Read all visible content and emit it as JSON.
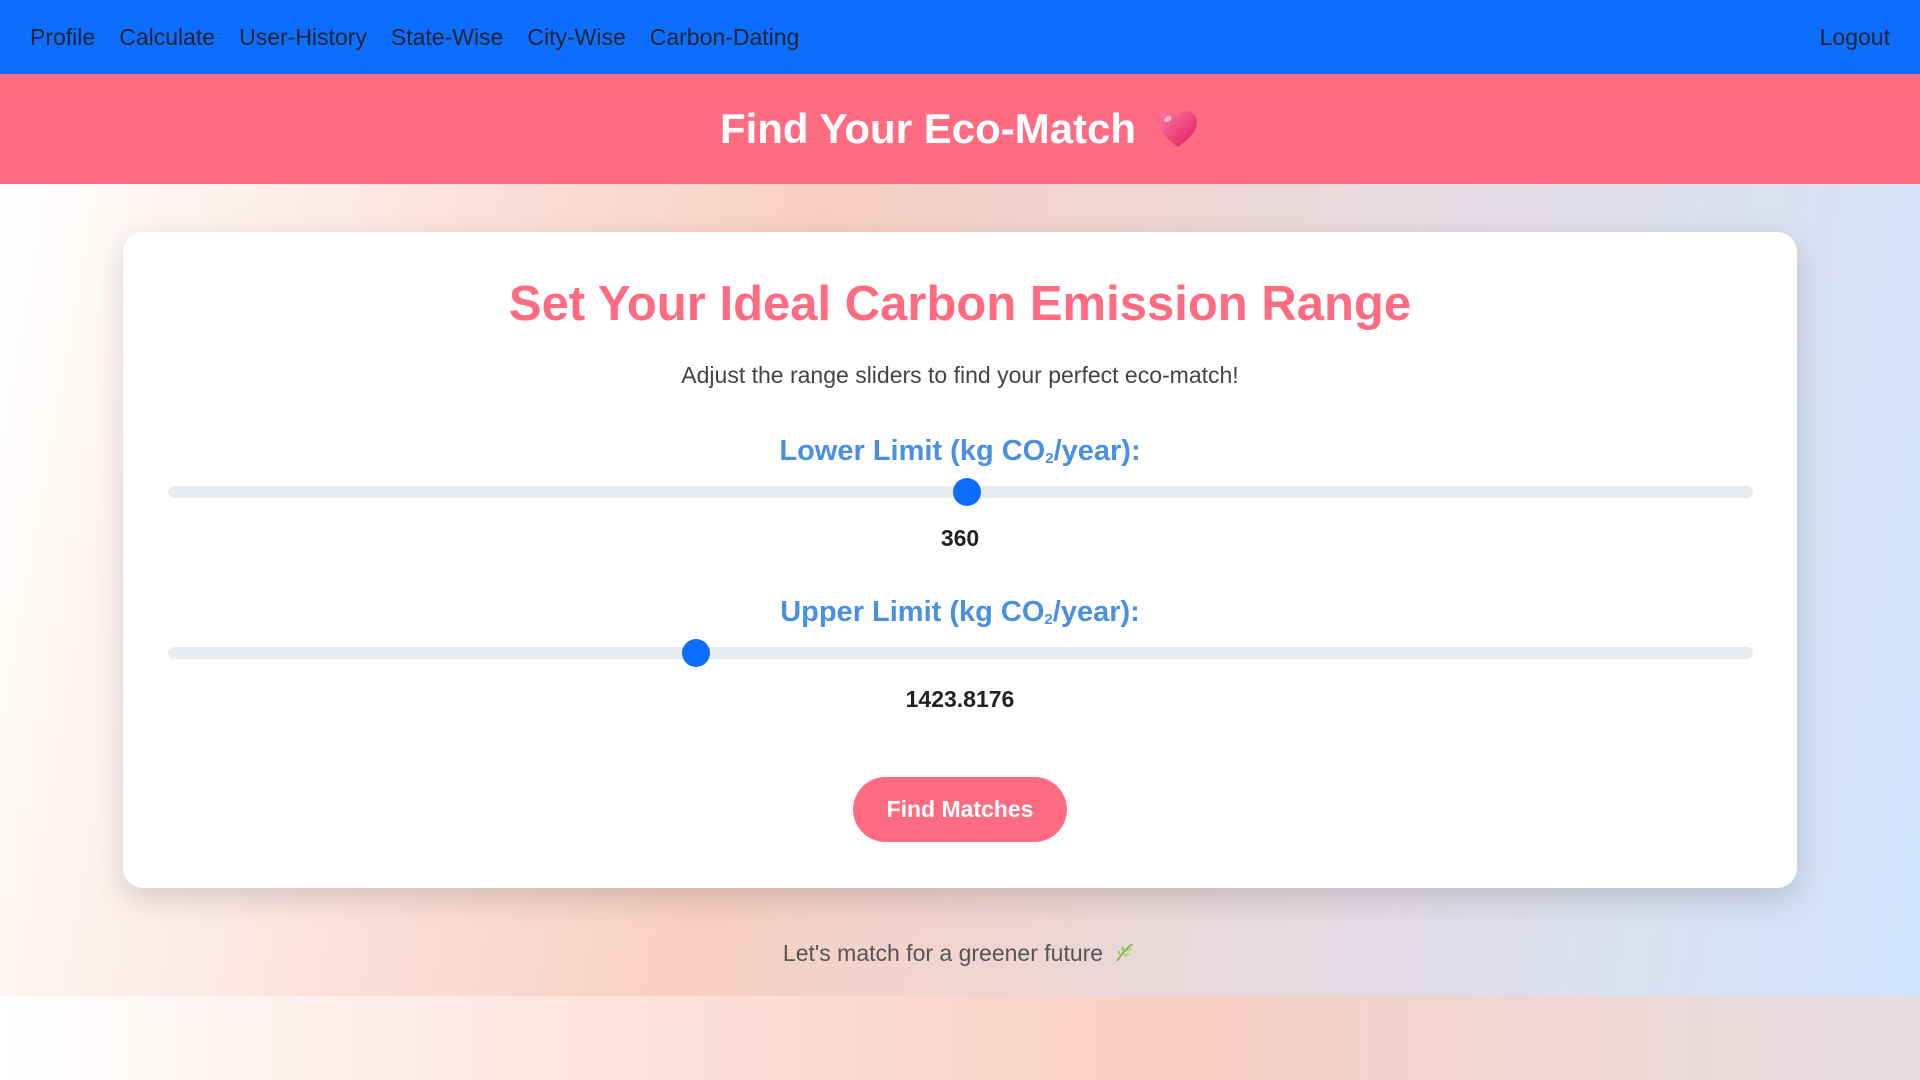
{
  "nav": {
    "links": [
      "Profile",
      "Calculate",
      "User-History",
      "State-Wise",
      "City-Wise",
      "Carbon-Dating"
    ],
    "logout": "Logout",
    "color": "#0d6efd"
  },
  "banner": {
    "title": "Find Your Eco-Match",
    "icon": "heart-icon",
    "color": "#ff6b81"
  },
  "card": {
    "title": "Set Your Ideal Carbon Emission Range",
    "subtitle": "Adjust the range sliders to find your perfect eco-match!",
    "lower": {
      "label_prefix": "Lower Limit (kg CO",
      "label_sub": "2",
      "label_suffix": "/year):",
      "value": "360",
      "fraction": 0.504
    },
    "upper": {
      "label_prefix": "Upper Limit (kg CO",
      "label_sub": "2",
      "label_suffix": "/year):",
      "value": "1423.8176",
      "fraction": 0.333
    },
    "button_label": "Find Matches"
  },
  "footer": {
    "text": "Let's match for a greener future",
    "icon": "leaf-icon"
  }
}
